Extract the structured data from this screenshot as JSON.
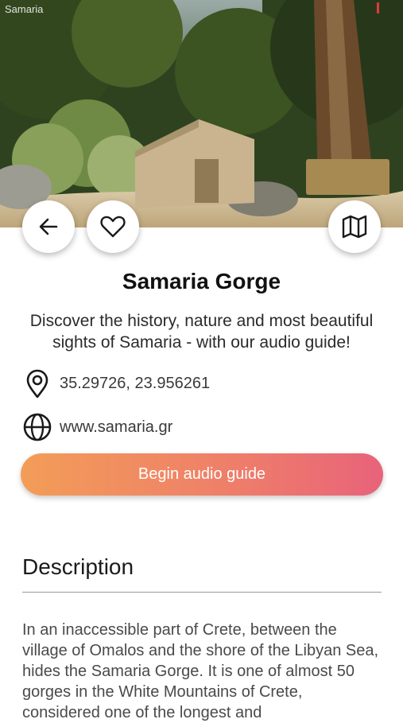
{
  "status_bar": {
    "left_text": "Samaria"
  },
  "hero": {
    "image": "stone hut among pine trees in Samaria Gorge"
  },
  "actions": {
    "back_icon": "arrow-left-icon",
    "favorite_icon": "heart-outline-icon",
    "map_icon": "map-icon"
  },
  "place": {
    "title": "Samaria Gorge",
    "subtitle": "Discover the history, nature and most beautiful sights of Samaria - with our audio guide!",
    "coordinates": "35.29726, 23.956261",
    "website": "www.samaria.gr"
  },
  "cta": {
    "label": "Begin audio guide"
  },
  "description": {
    "heading": "Description",
    "text": "In an inaccessible part of Crete, between the village of Omalos and the shore of the Libyan Sea, hides the Samaria Gorge. It is one of almost 50 gorges in the White Mountains of Crete, considered one of the longest and"
  },
  "colors": {
    "cta_start": "#f39d58",
    "cta_end": "#e8637a"
  }
}
